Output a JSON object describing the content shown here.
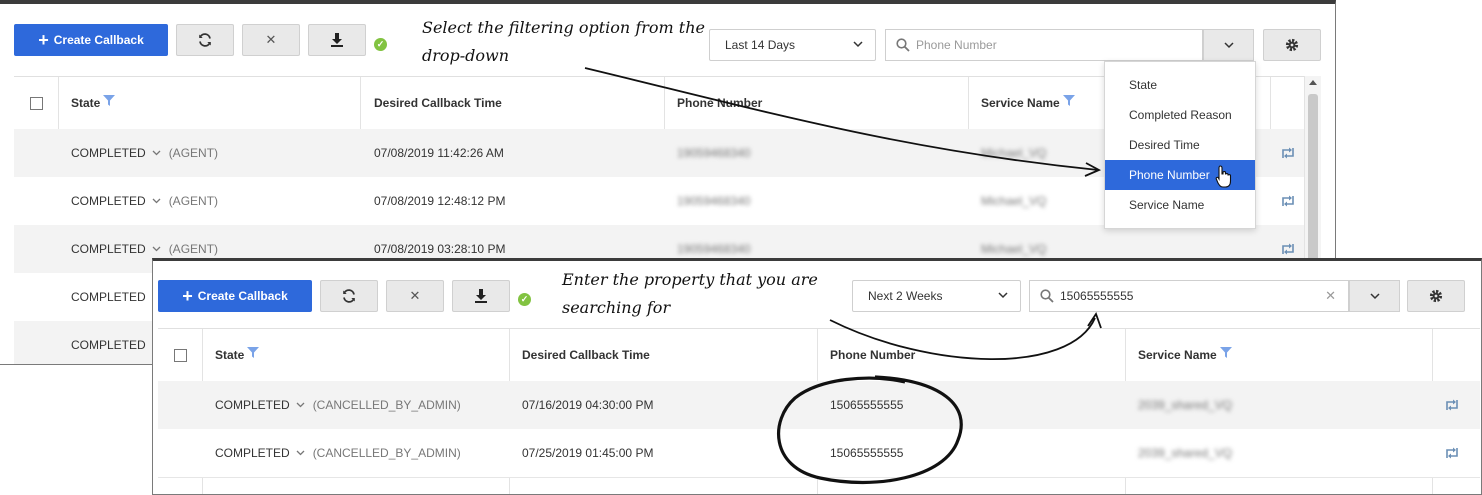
{
  "toolbar": {
    "create_label": "Create Callback",
    "refresh_icon": "refresh-icon",
    "clear_icon": "close-icon",
    "download_icon": "download-icon",
    "status_icon": "check-circle-icon"
  },
  "top_panel": {
    "date_range": "Last 14 Days",
    "search_placeholder": "Phone Number",
    "filter_options": [
      "State",
      "Completed Reason",
      "Desired Time",
      "Phone Number",
      "Service Name"
    ],
    "selected_option": "Phone Number",
    "columns": [
      "State",
      "Desired Callback Time",
      "Phone Number",
      "Service Name"
    ],
    "rows": [
      {
        "state": "COMPLETED",
        "reason": "(AGENT)",
        "time": "07/08/2019 11:42:26 AM",
        "phone": "19059468340",
        "service": "Michael_VQ"
      },
      {
        "state": "COMPLETED",
        "reason": "(AGENT)",
        "time": "07/08/2019 12:48:12 PM",
        "phone": "19059468340",
        "service": "Michael_VQ"
      },
      {
        "state": "COMPLETED",
        "reason": "(AGENT)",
        "time": "07/08/2019 03:28:10 PM",
        "phone": "19059468340",
        "service": "Michael_VQ"
      },
      {
        "state": "COMPLETED",
        "reason": "",
        "time": "",
        "phone": "",
        "service": ""
      },
      {
        "state": "COMPLETED",
        "reason": "",
        "time": "",
        "phone": "",
        "service": ""
      }
    ]
  },
  "bottom_panel": {
    "date_range": "Next 2 Weeks",
    "search_value": "15065555555",
    "columns": [
      "State",
      "Desired Callback Time",
      "Phone Number",
      "Service Name"
    ],
    "rows": [
      {
        "state": "COMPLETED",
        "reason": "(CANCELLED_BY_ADMIN)",
        "time": "07/16/2019 04:30:00 PM",
        "phone": "15065555555",
        "service": "2039_shared_VQ"
      },
      {
        "state": "COMPLETED",
        "reason": "(CANCELLED_BY_ADMIN)",
        "time": "07/25/2019 01:45:00 PM",
        "phone": "15065555555",
        "service": "2039_shared_VQ"
      }
    ]
  },
  "annotations": {
    "top_line1": "Select the filtering option from the",
    "top_line2": "drop-down",
    "bottom_line1": "Enter the property that you are",
    "bottom_line2": "searching for"
  },
  "colors": {
    "primary": "#2e69db",
    "success": "#82c341"
  }
}
